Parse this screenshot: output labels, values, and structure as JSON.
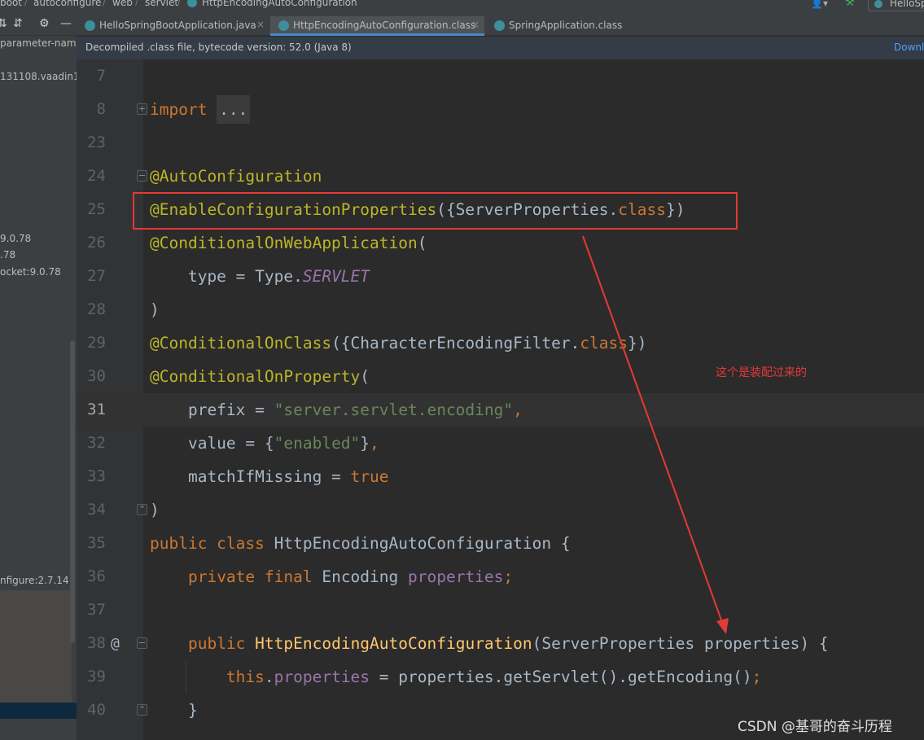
{
  "breadcrumbs": [
    "boot",
    "autoconfigure",
    "web",
    "servlet",
    "HttpEncodingAutoConfiguration"
  ],
  "toolbar_right": {
    "run_config": "HelloSp"
  },
  "project_tree": [
    "parameter-name",
    "131108.vaadin1",
    "9.0.78",
    ".78",
    "ocket:9.0.78",
    "nfigure:2.7.14"
  ],
  "tabs": [
    {
      "label": "HelloSpringBootApplication.java",
      "active": false
    },
    {
      "label": "HttpEncodingAutoConfiguration.class",
      "active": true
    },
    {
      "label": "SpringApplication.class",
      "active": false
    }
  ],
  "banner": {
    "text": "Decompiled .class file, bytecode version: 52.0 (Java 8)",
    "link": "Downl"
  },
  "editor": {
    "current_line": "31",
    "lines": [
      {
        "num": "7",
        "tokens": []
      },
      {
        "num": "8",
        "tokens": [
          [
            "kw",
            "import"
          ],
          [
            "plain",
            " "
          ],
          [
            "fold-dots",
            "..."
          ]
        ]
      },
      {
        "num": "23",
        "tokens": []
      },
      {
        "num": "24",
        "tokens": [
          [
            "ann",
            "@AutoConfiguration"
          ]
        ]
      },
      {
        "num": "25",
        "tokens": [
          [
            "ann",
            "@EnableConfigurationProperties"
          ],
          [
            "plain",
            "({ServerProperties."
          ],
          [
            "kw",
            "class"
          ],
          [
            "plain",
            "})"
          ]
        ]
      },
      {
        "num": "26",
        "tokens": [
          [
            "ann",
            "@ConditionalOnWebApplication"
          ],
          [
            "plain",
            "("
          ]
        ]
      },
      {
        "num": "27",
        "tokens": [
          [
            "plain",
            "    type = Type."
          ],
          [
            "cnst",
            "SERVLET"
          ]
        ]
      },
      {
        "num": "28",
        "tokens": [
          [
            "plain",
            ")"
          ]
        ]
      },
      {
        "num": "29",
        "tokens": [
          [
            "ann",
            "@ConditionalOnClass"
          ],
          [
            "plain",
            "({CharacterEncodingFilter."
          ],
          [
            "kw",
            "class"
          ],
          [
            "plain",
            "})"
          ]
        ]
      },
      {
        "num": "30",
        "tokens": [
          [
            "ann",
            "@ConditionalOnProperty"
          ],
          [
            "plain",
            "("
          ]
        ]
      },
      {
        "num": "31",
        "tokens": [
          [
            "plain",
            "    prefix = "
          ],
          [
            "str",
            "\"server.servlet.encoding\""
          ],
          [
            "kw",
            ","
          ]
        ]
      },
      {
        "num": "32",
        "tokens": [
          [
            "plain",
            "    value = {"
          ],
          [
            "str",
            "\"enabled\""
          ],
          [
            "plain",
            "}"
          ],
          [
            "kw",
            ","
          ]
        ]
      },
      {
        "num": "33",
        "tokens": [
          [
            "plain",
            "    matchIfMissing = "
          ],
          [
            "kw",
            "true"
          ]
        ]
      },
      {
        "num": "34",
        "tokens": [
          [
            "plain",
            ")"
          ]
        ]
      },
      {
        "num": "35",
        "tokens": [
          [
            "kw",
            "public class"
          ],
          [
            "plain",
            " HttpEncodingAutoConfiguration {"
          ]
        ]
      },
      {
        "num": "36",
        "tokens": [
          [
            "plain",
            "    "
          ],
          [
            "kw",
            "private final"
          ],
          [
            "plain",
            " Encoding "
          ],
          [
            "fld",
            "properties"
          ],
          [
            "kw",
            ";"
          ]
        ]
      },
      {
        "num": "37",
        "tokens": []
      },
      {
        "num": "38",
        "tokens": [
          [
            "plain",
            "    "
          ],
          [
            "kw",
            "public"
          ],
          [
            "plain",
            " "
          ],
          [
            "fn",
            "HttpEncodingAutoConfiguration"
          ],
          [
            "plain",
            "(ServerProperties properties) {"
          ]
        ]
      },
      {
        "num": "39",
        "tokens": [
          [
            "plain",
            "        "
          ],
          [
            "kw",
            "this"
          ],
          [
            "plain",
            "."
          ],
          [
            "fld",
            "properties"
          ],
          [
            "plain",
            " = properties.getServlet().getEncoding()"
          ],
          [
            "kw",
            ";"
          ]
        ]
      },
      {
        "num": "40",
        "tokens": [
          [
            "plain",
            "    }"
          ]
        ]
      }
    ]
  },
  "annotation": {
    "note": "这个是装配过来的",
    "color": "#e53935"
  },
  "watermark": "CSDN @基哥的奋斗历程"
}
